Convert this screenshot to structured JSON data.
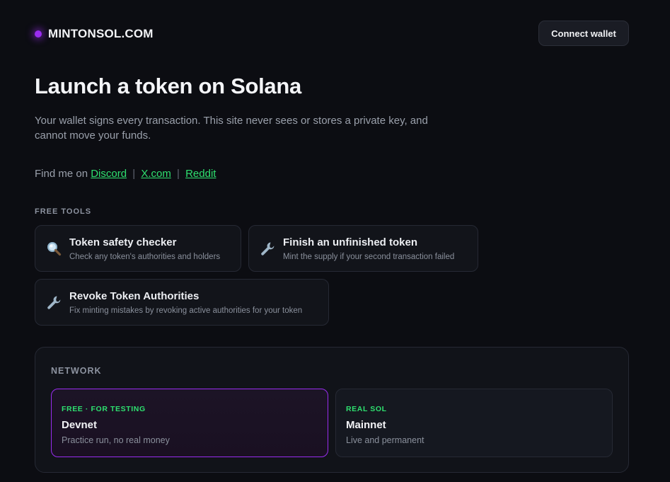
{
  "header": {
    "brand": "MINTONSOL.COM",
    "connect_label": "Connect wallet"
  },
  "hero": {
    "title": "Launch a token on Solana",
    "subtitle": "Your wallet signs every transaction. This site never sees or stores a private key, and cannot move your funds."
  },
  "social": {
    "prefix": "Find me on",
    "separator": "|",
    "links": [
      "Discord",
      "X.com",
      "Reddit"
    ]
  },
  "free_tools": {
    "label": "FREE TOOLS",
    "items": [
      {
        "icon": "magnifier-icon",
        "title": "Token safety checker",
        "desc": "Check any token's authorities and holders"
      },
      {
        "icon": "wrench-icon",
        "title": "Finish an unfinished token",
        "desc": "Mint the supply if your second transaction failed"
      },
      {
        "icon": "wrench-icon",
        "title": "Revoke Token Authorities",
        "desc": "Fix minting mistakes by revoking active authorities for your token"
      }
    ]
  },
  "network": {
    "label": "NETWORK",
    "options": [
      {
        "tag": "FREE · FOR TESTING",
        "name": "Devnet",
        "desc": "Practice run, no real money",
        "selected": true
      },
      {
        "tag": "REAL SOL",
        "name": "Mainnet",
        "desc": "Live and permanent",
        "selected": false
      }
    ]
  },
  "colors": {
    "background": "#0c0d12",
    "accent_purple": "#9a2cf0",
    "link_green": "#2ee06f"
  }
}
